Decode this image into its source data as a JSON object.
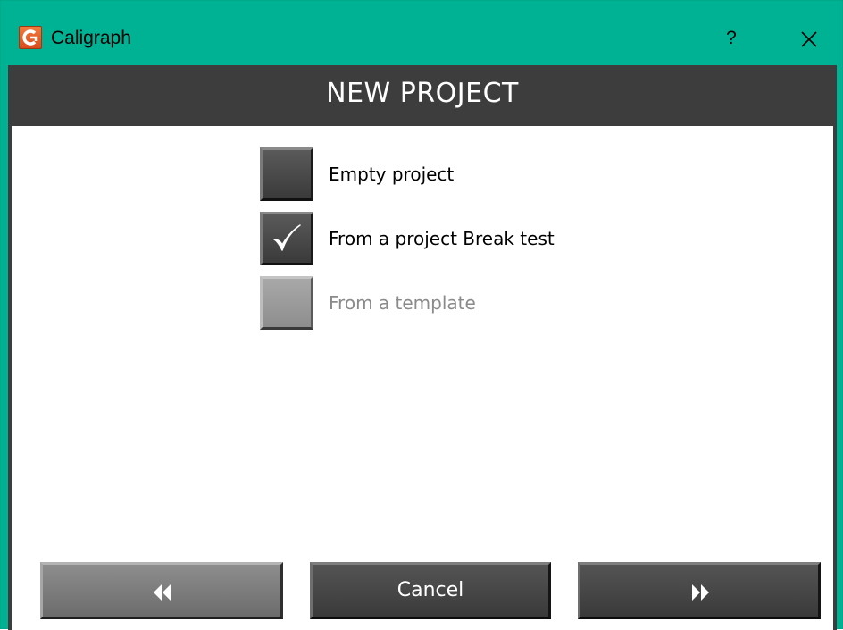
{
  "window": {
    "title": "Caligraph",
    "help_label": "?",
    "icon": "caligraph-app-icon",
    "close_icon": "close-icon",
    "titlebar_color": "#00b294"
  },
  "header": {
    "title": "NEW PROJECT",
    "background": "#3d3d3d"
  },
  "options": [
    {
      "label": "Empty project",
      "checked": false,
      "enabled": true
    },
    {
      "label": "From a project Break test",
      "checked": true,
      "enabled": true
    },
    {
      "label": "From a template",
      "checked": false,
      "enabled": false
    }
  ],
  "buttons": {
    "back_icon": "double-chevron-left-icon",
    "cancel_label": "Cancel",
    "next_icon": "double-chevron-right-icon"
  }
}
